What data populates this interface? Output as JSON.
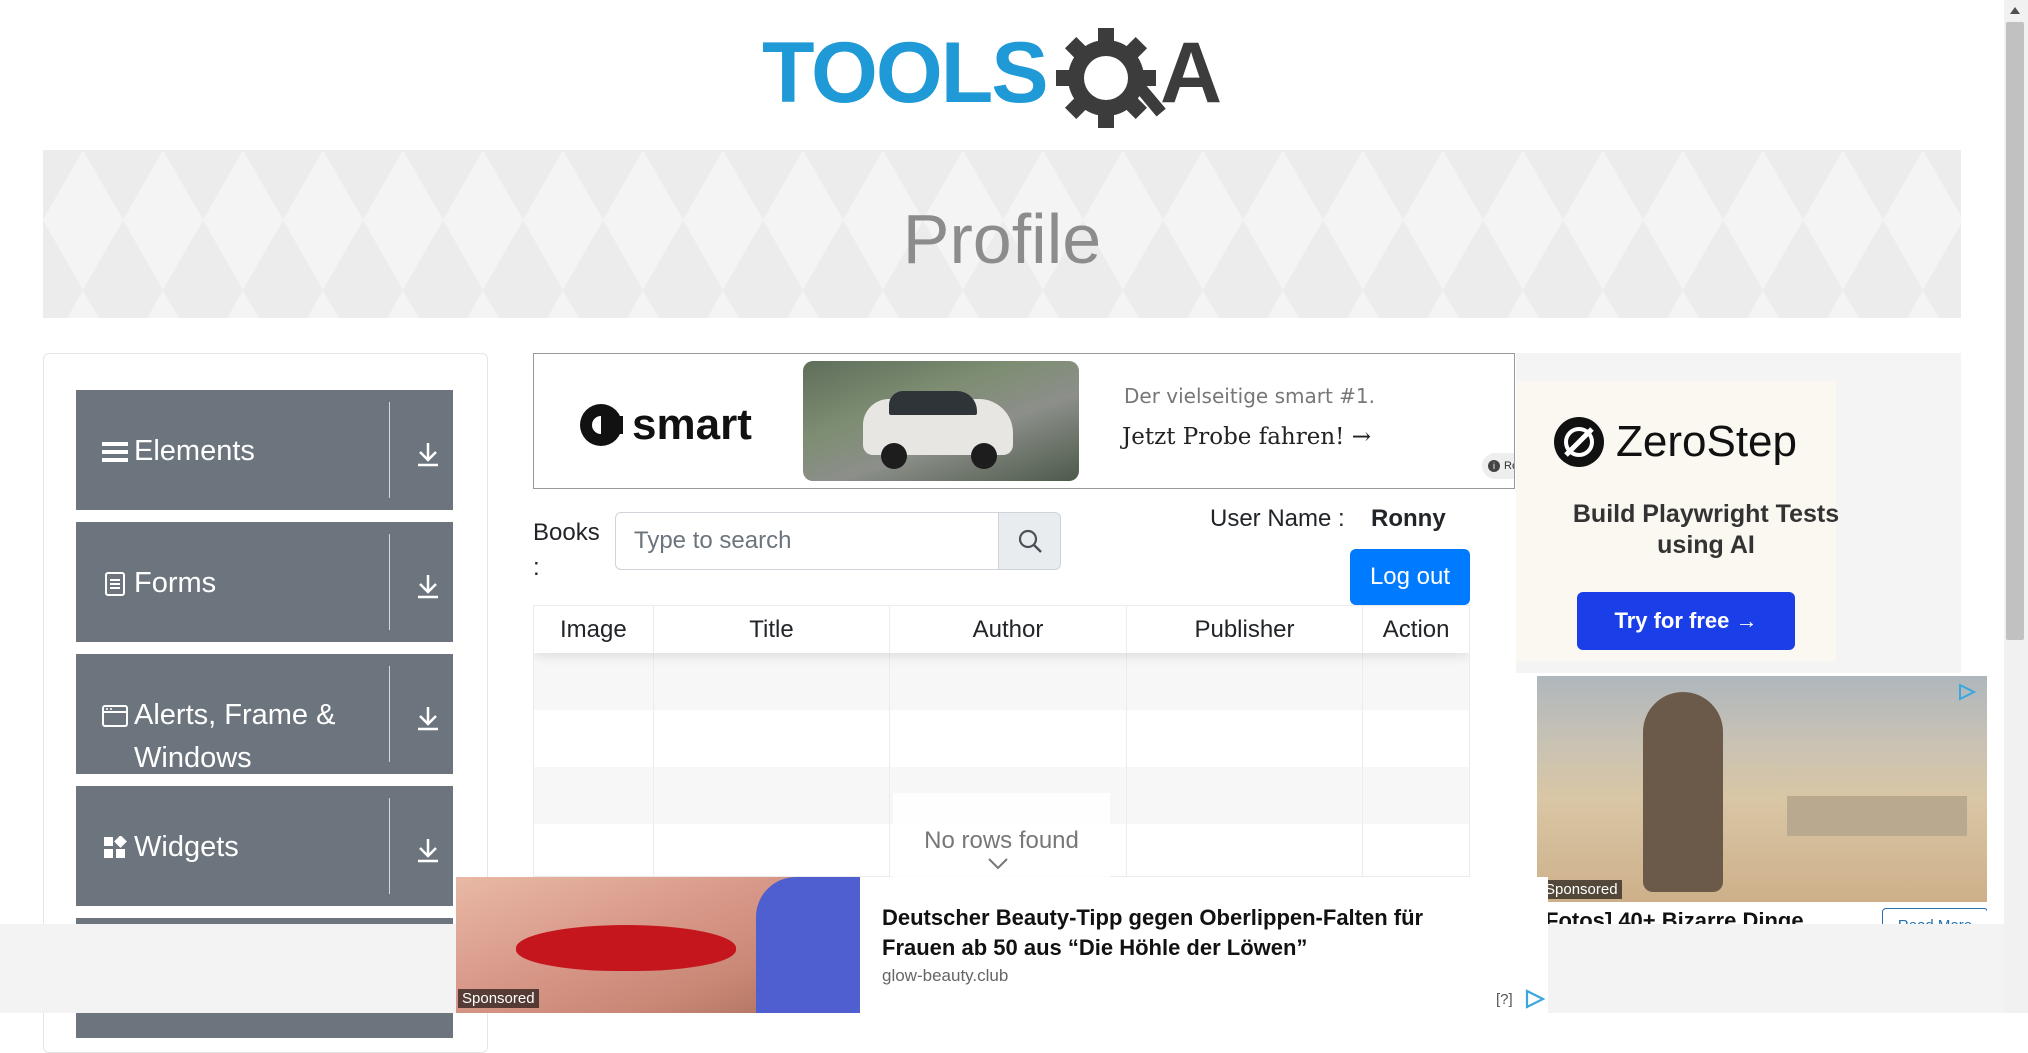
{
  "header": {
    "logo_text_tools": "TOOLS",
    "logo_text_qa": "A"
  },
  "banner": {
    "title": "Profile"
  },
  "sidebar": {
    "groups": [
      {
        "label": "Elements",
        "icon": "hamburger-icon"
      },
      {
        "label": "Forms",
        "icon": "document-icon"
      },
      {
        "label": "Alerts, Frame & Windows",
        "icon": "window-icon"
      },
      {
        "label": "Widgets",
        "icon": "widgets-icon"
      }
    ]
  },
  "smart_ad": {
    "brand": "smart",
    "tagline": "Der vielseitige smart #1.",
    "cta": "Jetzt Probe fahren! →",
    "info_badge": "Re"
  },
  "zerostep_ad": {
    "brand": "ZeroStep",
    "headline": "Build Playwright Tests using AI",
    "cta": "Try for free →"
  },
  "sponsored_ad": {
    "badge": "Sponsored",
    "headline": "Fotos] 40+ Bizarre Dinge",
    "button": "Read More"
  },
  "books": {
    "label": "Books :",
    "search_placeholder": "Type to search",
    "user_name_label": "User Name :",
    "user_name_value": "Ronny",
    "logout_label": "Log out"
  },
  "table": {
    "columns": [
      "Image",
      "Title",
      "Author",
      "Publisher",
      "Action"
    ],
    "empty_message": "No rows found"
  },
  "bottom_ad": {
    "badge": "Sponsored",
    "headline": "Deutscher Beauty-Tipp gegen Oberlippen-Falten für Frauen ab 50 aus “Die Höhle der Löwen”",
    "source": "glow-beauty.club",
    "help": "[?]"
  },
  "colors": {
    "sidebar_group": "#6c757d",
    "primary_button": "#007bff",
    "logo_blue": "#1f9ad6",
    "logo_dark": "#3c3c3c",
    "zerostep_cta": "#1a3ee8"
  }
}
